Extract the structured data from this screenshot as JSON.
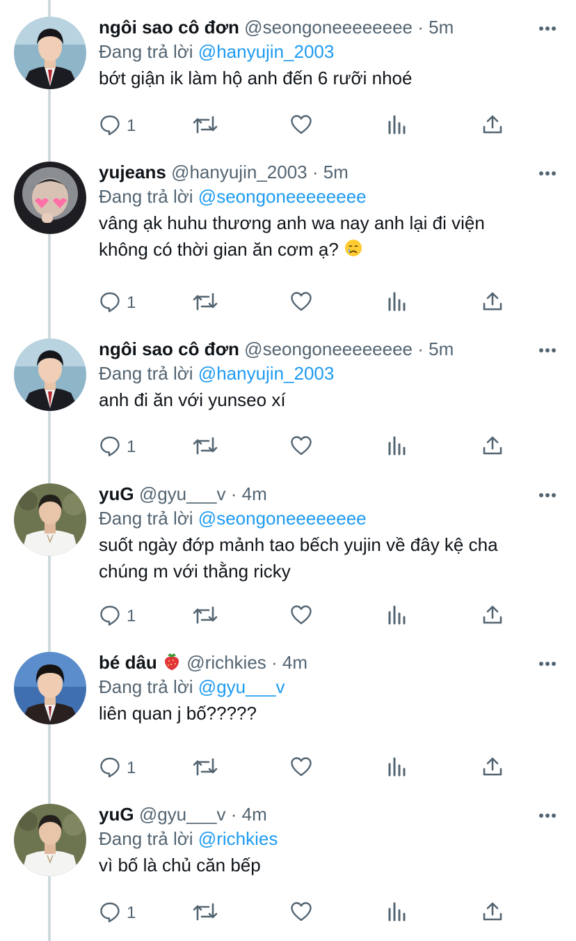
{
  "tweets": [
    {
      "name": "ngôi sao cô đơn",
      "emoji": "",
      "handle": "@seongoneeeeeeee",
      "time": "5m",
      "reply_prefix": "Đang trả lời",
      "reply_to": "@hanyujin_2003",
      "lines": [
        "bớt giận ik làm hộ anh đến 6 rưỡi nhoé"
      ],
      "text_emoji": "",
      "reply_count": "1",
      "avatar": "boy-in-school-uniform"
    },
    {
      "name": "yujeans",
      "emoji": "",
      "handle": "@hanyujin_2003",
      "time": "5m",
      "reply_prefix": "Đang trả lời",
      "reply_to": "@seongoneeeeeeee",
      "lines": [
        "vâng ạk huhu thương anh wa nay anh lại đi viện",
        "không có thời gian ăn cơm ạ?"
      ],
      "text_emoji": "crying-face",
      "reply_count": "1",
      "avatar": "boy-in-hoodie-heart-glasses"
    },
    {
      "name": "ngôi sao cô đơn",
      "emoji": "",
      "handle": "@seongoneeeeeeee",
      "time": "5m",
      "reply_prefix": "Đang trả lời",
      "reply_to": "@hanyujin_2003",
      "lines": [
        "anh đi ăn với yunseo xí"
      ],
      "text_emoji": "",
      "reply_count": "1",
      "avatar": "boy-in-school-uniform"
    },
    {
      "name": "yuG",
      "emoji": "",
      "handle": "@gyu___v",
      "time": "4m",
      "reply_prefix": "Đang trả lời",
      "reply_to": "@seongoneeeeeeee",
      "lines": [
        "suốt ngày đớp mảnh tao bếch yujin về đây kệ cha",
        "chúng m với thằng ricky"
      ],
      "text_emoji": "",
      "reply_count": "1",
      "avatar": "boy-in-white-tshirt"
    },
    {
      "name": "bé dâu",
      "emoji": "strawberry",
      "handle": "@richkies",
      "time": "4m",
      "reply_prefix": "Đang trả lời",
      "reply_to": "@gyu___v",
      "lines": [
        "liên quan j bố?????"
      ],
      "text_emoji": "",
      "reply_count": "1",
      "avatar": "boy-blue-background-uniform"
    },
    {
      "name": "yuG",
      "emoji": "",
      "handle": "@gyu___v",
      "time": "4m",
      "reply_prefix": "Đang trả lời",
      "reply_to": "@richkies",
      "lines": [
        "vì bố là chủ căn bếp"
      ],
      "text_emoji": "",
      "reply_count": "1",
      "avatar": "boy-in-white-tshirt"
    }
  ],
  "colors": {
    "accent": "#1d9bf0",
    "muted": "#536471",
    "text": "#0f1419",
    "thread": "#cfd9de"
  }
}
